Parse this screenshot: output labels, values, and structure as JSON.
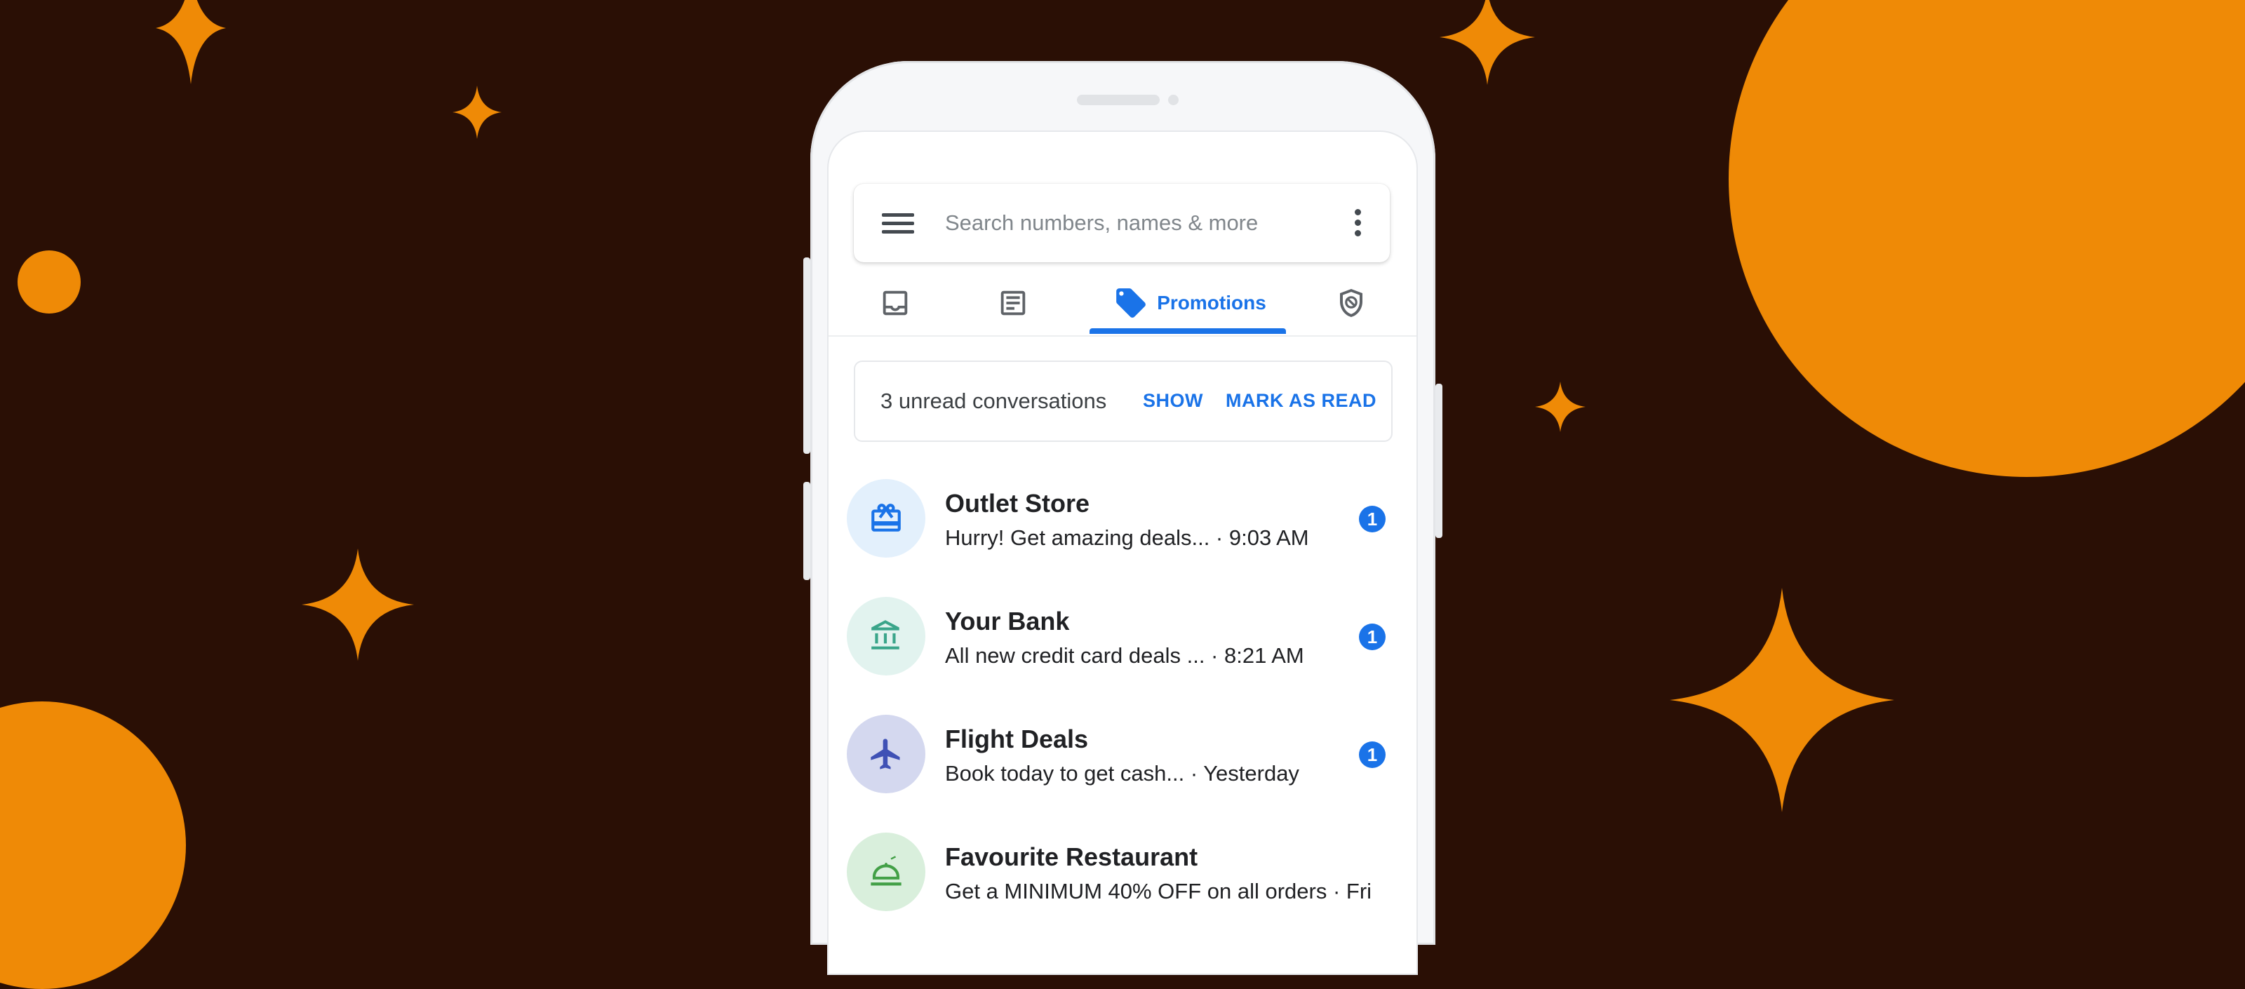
{
  "colors": {
    "background": "#2a0f05",
    "accent_orange": "#ef8a06",
    "brand_blue": "#1a73e8"
  },
  "search": {
    "placeholder": "Search numbers, names & more",
    "menu_icon": "hamburger-menu-icon",
    "overflow_icon": "more-vert-icon"
  },
  "tabs": [
    {
      "icon": "inbox-icon",
      "label": ""
    },
    {
      "icon": "article-icon",
      "label": ""
    },
    {
      "icon": "tag-icon",
      "label": "Promotions",
      "selected": true
    },
    {
      "icon": "spam-shield-icon",
      "label": ""
    }
  ],
  "unread_bar": {
    "text": "3 unread conversations",
    "show_label": "SHOW",
    "mark_read_label": "MARK AS READ"
  },
  "conversations": [
    {
      "name": "Outlet Store",
      "snippet": "Hurry! Get amazing deals... · 9:03 AM",
      "unread": "1",
      "icon": "gift-card-icon",
      "avatar_color": "#e3f0fc",
      "icon_color": "#1a73e8"
    },
    {
      "name": "Your Bank",
      "snippet": "All new credit card deals ... · 8:21 AM",
      "unread": "1",
      "icon": "bank-icon",
      "avatar_color": "#e2f3ef",
      "icon_color": "#3aa58a"
    },
    {
      "name": "Flight Deals",
      "snippet": "Book today to get cash... · Yesterday",
      "unread": "1",
      "icon": "airplane-icon",
      "avatar_color": "#d4d8ef",
      "icon_color": "#3f51b5"
    },
    {
      "name": "Favourite Restaurant",
      "snippet": "Get a MINIMUM 40% OFF on all orders · Fri",
      "unread": "",
      "icon": "food-icon",
      "avatar_color": "#d9efdc",
      "icon_color": "#43a047"
    }
  ]
}
